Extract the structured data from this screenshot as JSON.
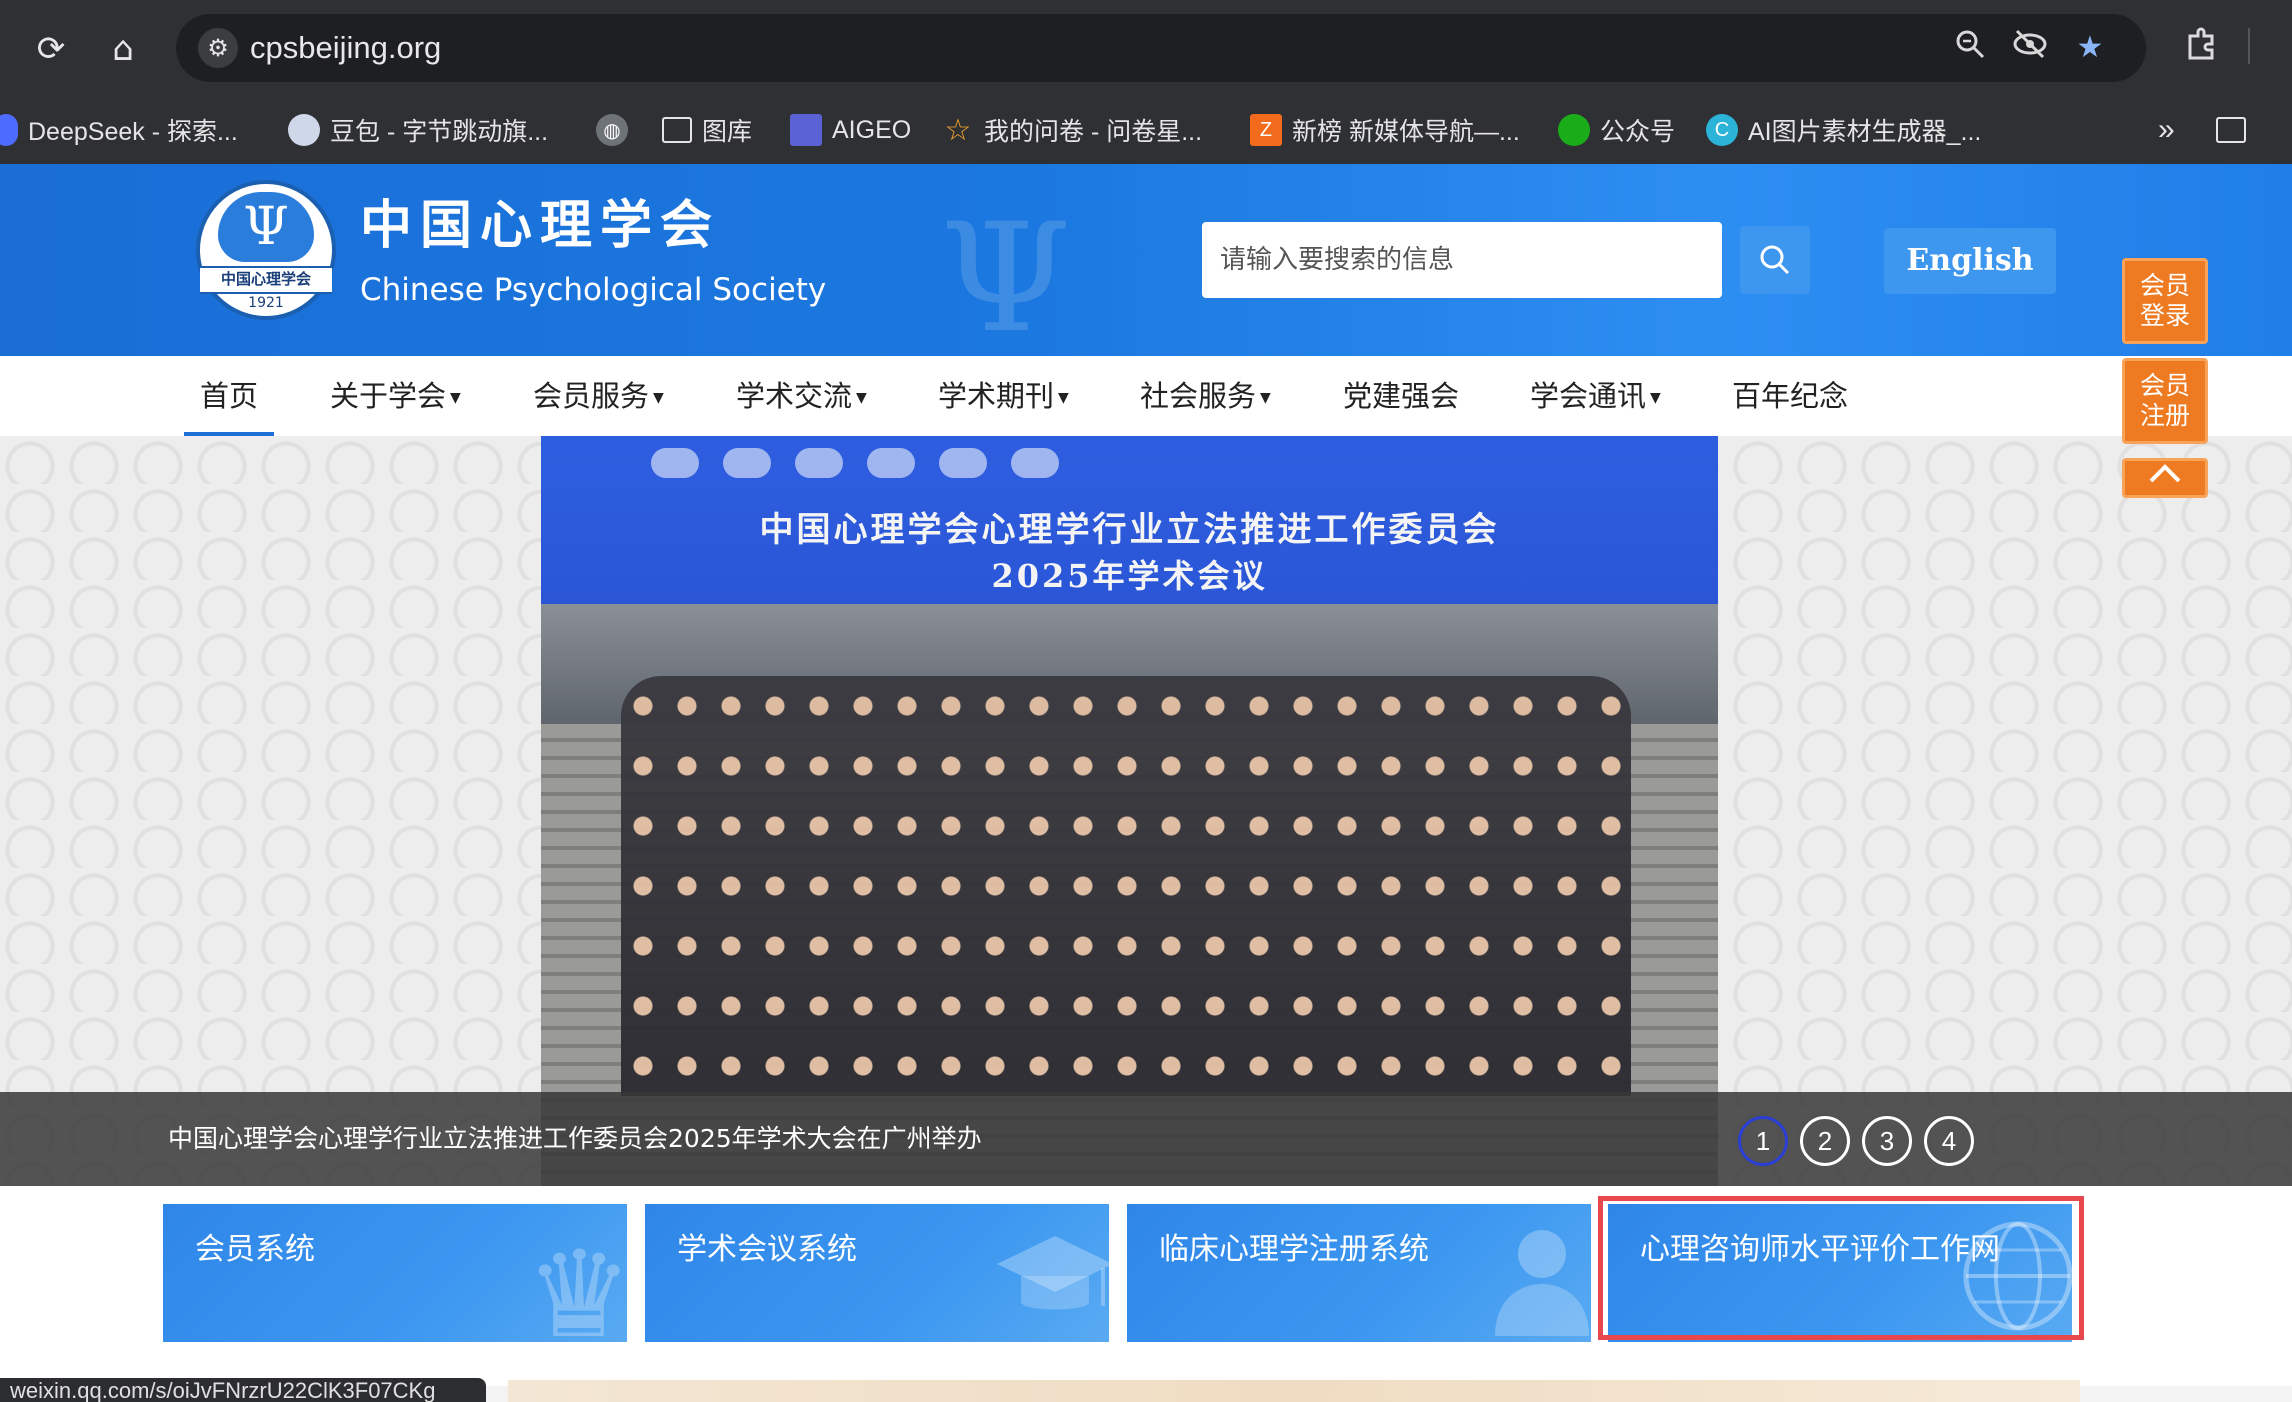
{
  "browser": {
    "url": "cpsbeijing.org",
    "bookmarks": [
      {
        "label": "DeepSeek - 探索...",
        "icon": "deepseek-icon",
        "color": "#4d6bfe"
      },
      {
        "label": "豆包 - 字节跳动旗...",
        "icon": "doubao-icon",
        "color": "#cfd8e8"
      },
      {
        "label": "",
        "icon": "globe-icon",
        "color": "#9aa0a6"
      },
      {
        "label": "图库",
        "icon": "folder-icon",
        "color": "#e5e5e5"
      },
      {
        "label": "AIGEO",
        "icon": "aigeo-icon",
        "color": "#5b62d6"
      },
      {
        "label": "我的问卷 - 问卷星...",
        "icon": "star-outline-icon",
        "color": "#f2a52b"
      },
      {
        "label": "新榜 新媒体导航—...",
        "icon": "xinbang-icon",
        "color": "#f26a1b"
      },
      {
        "label": "公众号",
        "icon": "wechat-icon",
        "color": "#1aad19"
      },
      {
        "label": "AI图片素材生成器_...",
        "icon": "canva-icon",
        "color": "#2bb3d8"
      }
    ],
    "status_url": "weixin.qq.com/s/oiJvFNrzrU22ClK3F07CKg"
  },
  "header": {
    "logo_cn": "中国心理学会",
    "logo_en": "Chinese Psychological Society",
    "seal_band": "中国心理学会",
    "seal_year": "1921",
    "search_placeholder": "请输入要搜索的信息",
    "english_label": "English"
  },
  "nav": [
    {
      "label": "首页",
      "dropdown": false
    },
    {
      "label": "关于学会",
      "dropdown": true
    },
    {
      "label": "会员服务",
      "dropdown": true
    },
    {
      "label": "学术交流",
      "dropdown": true
    },
    {
      "label": "学术期刊",
      "dropdown": true
    },
    {
      "label": "社会服务",
      "dropdown": true
    },
    {
      "label": "党建强会",
      "dropdown": false
    },
    {
      "label": "学会通讯",
      "dropdown": true
    },
    {
      "label": "百年纪念",
      "dropdown": false
    }
  ],
  "banner": {
    "photo_title_line1": "中国心理学会心理学行业立法推进工作委员会",
    "photo_title_line2": "2025年学术会议",
    "caption": "中国心理学会心理学行业立法推进工作委员会2025年学术大会在广州举办",
    "pages": [
      "1",
      "2",
      "3",
      "4"
    ],
    "active_page": "1"
  },
  "side": {
    "login": "会员\n登录",
    "register": "会员\n注册",
    "login_l1": "会员",
    "login_l2": "登录",
    "register_l1": "会员",
    "register_l2": "注册"
  },
  "tiles": [
    {
      "label": "会员系统",
      "icon": "crown-icon"
    },
    {
      "label": "学术会议系统",
      "icon": "graduation-cap-icon"
    },
    {
      "label": "临床心理学注册系统",
      "icon": "person-icon"
    },
    {
      "label": "心理咨询师水平评价工作网",
      "icon": "globe-icon"
    }
  ],
  "colors": {
    "header_blue": "#1b78e0",
    "accent_orange": "#ee7a22",
    "highlight_red": "#e8474d",
    "tile_blue": "#3b97f0"
  }
}
